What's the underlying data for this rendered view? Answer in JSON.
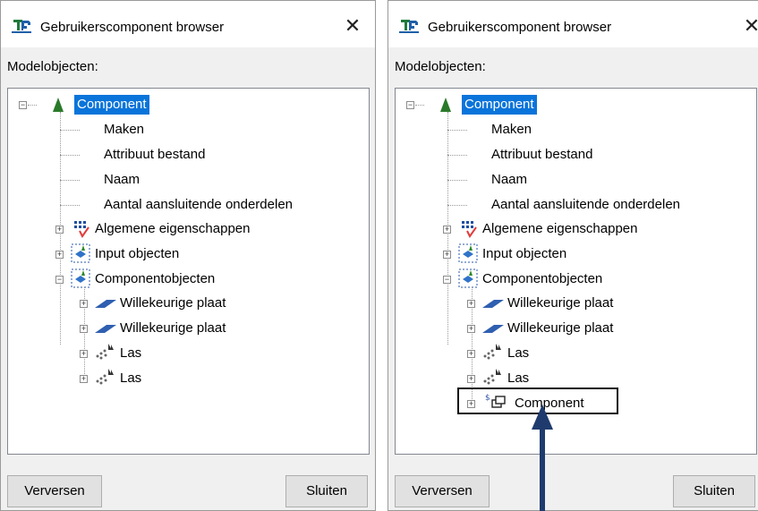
{
  "left_dialog": {
    "title": "Gebruikerscomponent browser",
    "section_label": "Modelobjecten:",
    "tree": {
      "root": "Component",
      "root_children": [
        "Maken",
        "Attribuut bestand",
        "Naam",
        "Aantal aansluitende onderdelen"
      ],
      "groups": [
        "Algemene eigenschappen",
        "Input objecten",
        "Componentobjecten"
      ],
      "component_objects": [
        "Willekeurige plaat",
        "Willekeurige plaat",
        "Las",
        "Las"
      ]
    },
    "buttons": {
      "refresh": "Verversen",
      "close": "Sluiten"
    }
  },
  "right_dialog": {
    "title": "Gebruikerscomponent browser",
    "section_label": "Modelobjecten:",
    "tree": {
      "root": "Component",
      "root_children": [
        "Maken",
        "Attribuut bestand",
        "Naam",
        "Aantal aansluitende onderdelen"
      ],
      "groups": [
        "Algemene eigenschappen",
        "Input objecten",
        "Componentobjecten"
      ],
      "component_objects": [
        "Willekeurige plaat",
        "Willekeurige plaat",
        "Las",
        "Las",
        "Component"
      ]
    },
    "buttons": {
      "refresh": "Verversen",
      "close": "Sluiten"
    }
  },
  "colors": {
    "selection": "#0a74da",
    "arrow": "#1f3b6e"
  }
}
